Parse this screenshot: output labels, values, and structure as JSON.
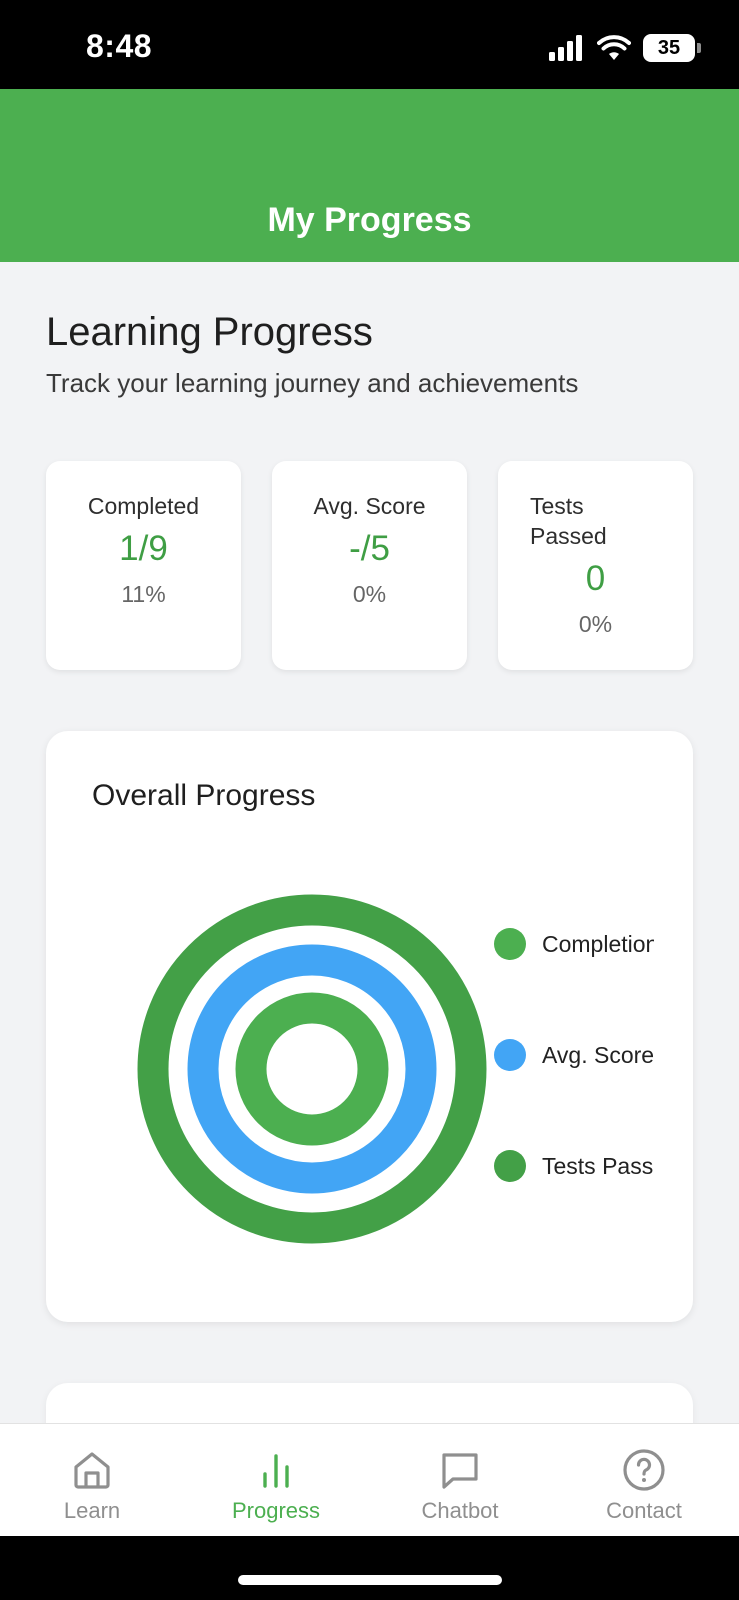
{
  "status_bar": {
    "time": "8:48",
    "battery": "35"
  },
  "header": {
    "title": "My Progress"
  },
  "page": {
    "title": "Learning Progress",
    "subtitle": "Track your learning journey and achievements"
  },
  "stats": [
    {
      "label": "Completed",
      "value": "1/9",
      "sub": "11%"
    },
    {
      "label": "Avg. Score",
      "value": "-/5",
      "sub": "0%"
    },
    {
      "label_line1": "Tests",
      "label_line2": "Passed",
      "value": "0",
      "sub": "0%"
    }
  ],
  "overall_progress": {
    "title": "Overall Progress",
    "legend": [
      {
        "label": "Completion",
        "color": "#4caf50"
      },
      {
        "label": "Avg. Score",
        "color": "#42a5f5"
      },
      {
        "label": "Tests Passed",
        "color": "#43a047"
      }
    ]
  },
  "nav": {
    "items": [
      {
        "label": "Learn",
        "icon": "home-icon",
        "active": false
      },
      {
        "label": "Progress",
        "icon": "bar-chart-icon",
        "active": true
      },
      {
        "label": "Chatbot",
        "icon": "chat-bubble-icon",
        "active": false
      },
      {
        "label": "Contact",
        "icon": "help-circle-icon",
        "active": false
      }
    ]
  },
  "colors": {
    "primary": "#4caf50",
    "value_text": "#3f9e44",
    "ring_outer": "#43a047",
    "ring_middle": "#42a5f5",
    "ring_inner": "#4caf50"
  }
}
